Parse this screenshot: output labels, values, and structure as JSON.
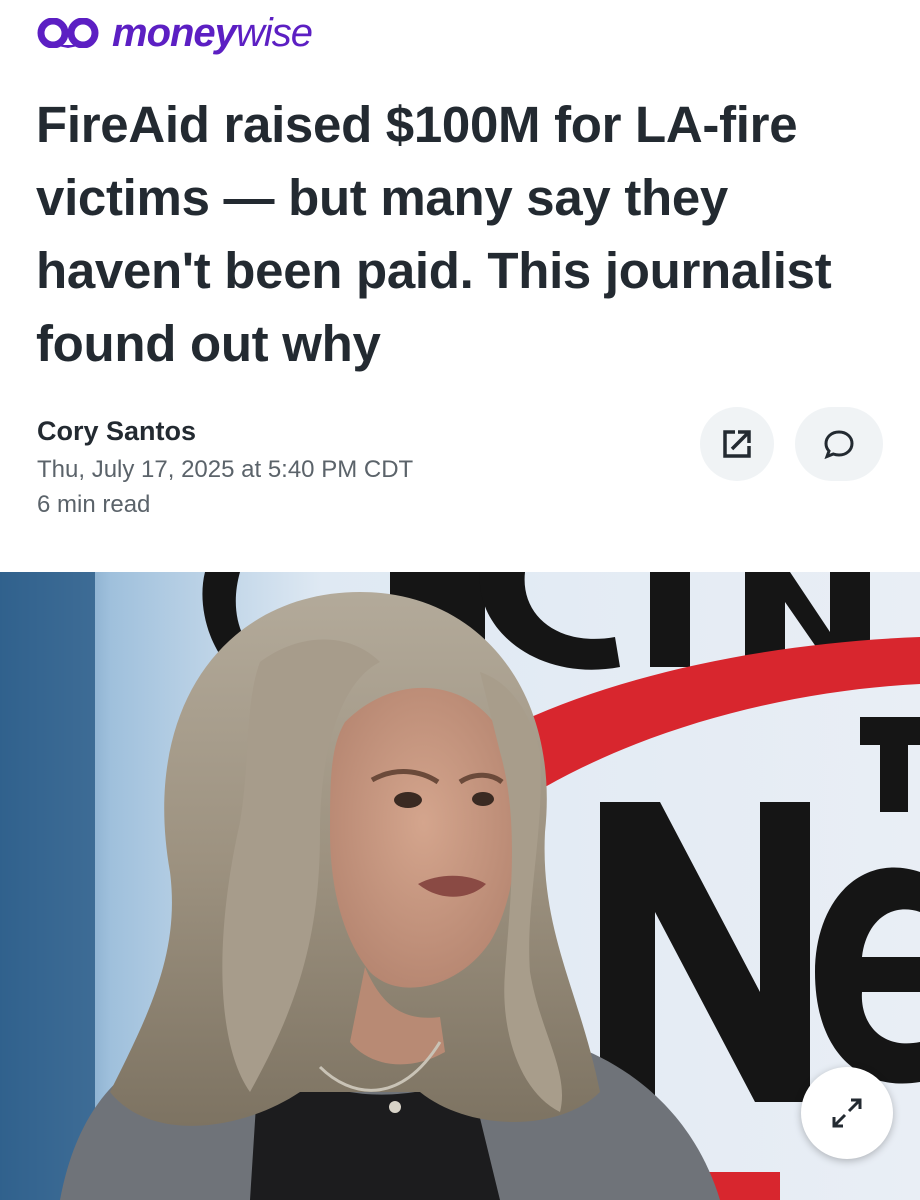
{
  "brand": {
    "name_bold": "money",
    "name_light": "wise",
    "color": "#5c1fc3",
    "icon": "moneywise-logo-icon"
  },
  "article": {
    "headline": "FireAid raised $100M for LA-fire victims — but many say they haven't been paid. This journalist found out why",
    "author": "Cory Santos",
    "date": "Thu, July 17, 2025 at 5:40 PM CDT",
    "read_time": "6 min read"
  },
  "actions": {
    "share_icon": "share-icon",
    "comment_icon": "comment-icon",
    "expand_icon": "expand-icon"
  },
  "hero": {
    "description_icon": "hero-photo"
  },
  "colors": {
    "text": "#232a31",
    "muted": "#5b636a",
    "button_bg": "#f0f3f5"
  }
}
